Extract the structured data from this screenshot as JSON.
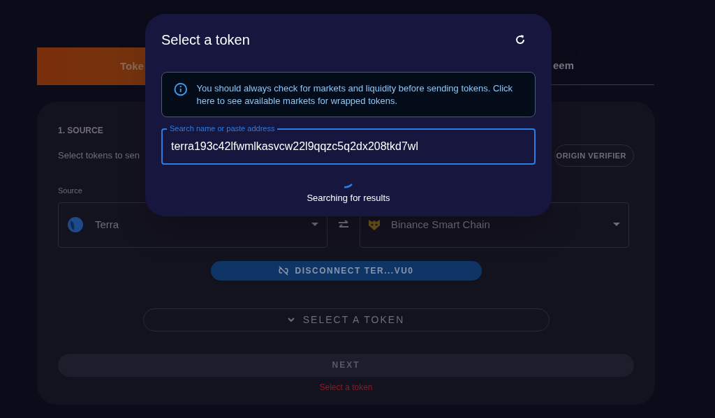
{
  "tabs": [
    {
      "label": "Toke",
      "selected": true
    },
    {
      "label": "eem",
      "selected": false
    }
  ],
  "source_section": {
    "heading": "1. SOURCE",
    "description": "Select tokens to sen",
    "origin_verifier": "ORIGIN VERIFIER",
    "source_label": "Source",
    "chains": [
      {
        "name": "Terra",
        "kind": "terra"
      },
      {
        "name": "Binance Smart Chain",
        "kind": "bsc"
      }
    ],
    "disconnect_button": "DISCONNECT TER...VU0",
    "select_token_button": "SELECT A TOKEN",
    "next_button": {
      "label": "NEXT",
      "disabled": true
    },
    "error": "Select a token"
  },
  "dialog": {
    "title": "Select a token",
    "notice": "You should always check for markets and liquidity before sending tokens. Click here to see available markets for wrapped tokens.",
    "search": {
      "label": "Search name or paste address",
      "value": "terra193c42lfwmlkasvcw22l9qqzc5q2dx208tkd7wl"
    },
    "status": "Searching for results"
  }
}
